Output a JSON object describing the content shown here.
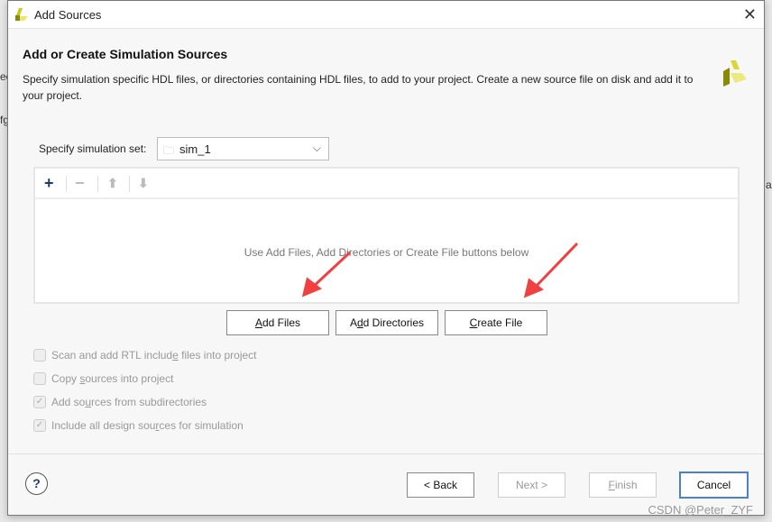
{
  "window": {
    "title": "Add Sources",
    "close_icon": "close-icon"
  },
  "background_fragments": [
    "ec",
    "fg",
    "a"
  ],
  "heading": "Add or Create Simulation Sources",
  "description": "Specify simulation specific HDL files, or directories containing HDL files, to add to your project. Create a new source file on disk and add it to your project.",
  "simset": {
    "label": "Specify simulation set:",
    "value": "sim_1"
  },
  "toolbar": {
    "add": "+",
    "remove": "−",
    "up": "⬆",
    "down": "⬇"
  },
  "empty_message": "Use Add Files, Add Directories or Create File buttons below",
  "buttons": {
    "add_files": {
      "label": "Add Files",
      "mnemonic": 0
    },
    "add_directories": {
      "label": "Add Directories",
      "mnemonic": 1
    },
    "create_file": {
      "label": "Create File",
      "mnemonic": 0
    },
    "back": {
      "label": "< Back",
      "mnemonic": 2
    },
    "next": {
      "label": "Next >",
      "mnemonic": 0
    },
    "finish": {
      "label": "Finish",
      "mnemonic": 0
    },
    "cancel": {
      "label": "Cancel",
      "mnemonic": -1
    }
  },
  "options": [
    {
      "label": "Scan and add RTL include files into project",
      "checked": false,
      "mnemonic": 23
    },
    {
      "label": "Copy sources into project",
      "checked": false,
      "mnemonic": 5
    },
    {
      "label": "Add sources from subdirectories",
      "checked": true,
      "mnemonic": 6
    },
    {
      "label": "Include all design sources for simulation",
      "checked": true,
      "mnemonic": 22
    }
  ],
  "watermark": "CSDN @Peter_ZYF",
  "colors": {
    "accent": "#4d7fd0",
    "annotation_arrow": "#f04040",
    "logo": "#c8c820"
  }
}
